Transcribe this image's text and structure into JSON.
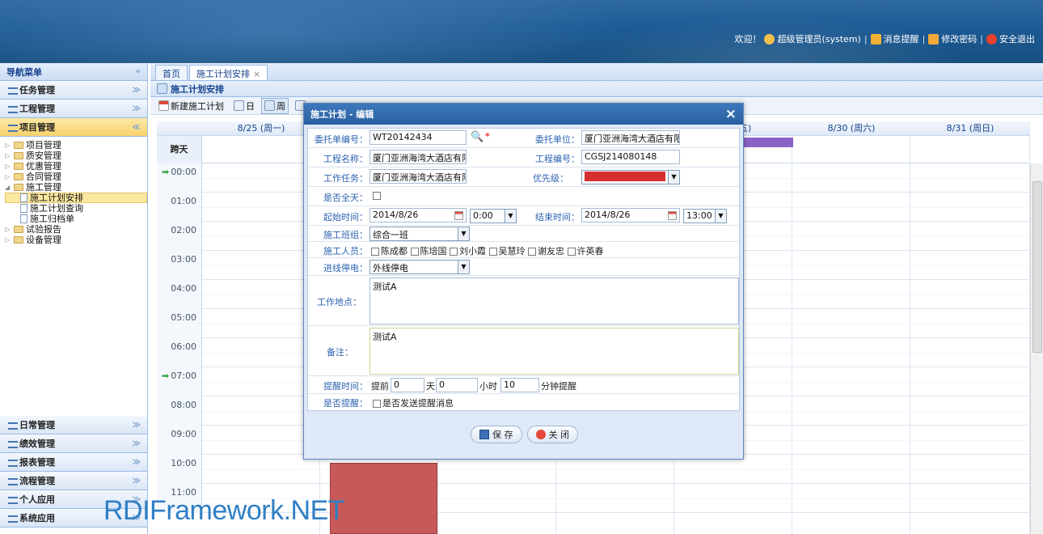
{
  "header": {
    "welcome": "欢迎！",
    "user": "超级管理员(system)",
    "messages": "消息提醒",
    "change_password": "修改密码",
    "logout": "安全退出"
  },
  "sidebar": {
    "title": "导航菜单",
    "collapse_glyph": "«",
    "groups_top": [
      {
        "label": "任务管理"
      },
      {
        "label": "工程管理"
      },
      {
        "label": "项目管理"
      }
    ],
    "tree": [
      {
        "label": "项目管理",
        "level": 0
      },
      {
        "label": "质安管理",
        "level": 0
      },
      {
        "label": "优惠管理",
        "level": 0
      },
      {
        "label": "合同管理",
        "level": 0
      },
      {
        "label": "施工管理",
        "level": 0
      },
      {
        "label": "施工计划安排",
        "level": 1
      },
      {
        "label": "施工计划查询",
        "level": 1
      },
      {
        "label": "施工归档单",
        "level": 1
      },
      {
        "label": "试验报告",
        "level": 0
      },
      {
        "label": "设备管理",
        "level": 0
      }
    ],
    "groups_bottom": [
      {
        "label": "日常管理"
      },
      {
        "label": "绩效管理"
      },
      {
        "label": "报表管理"
      },
      {
        "label": "流程管理"
      },
      {
        "label": "个人应用"
      },
      {
        "label": "系统应用"
      }
    ]
  },
  "tabs": [
    {
      "label": "首页"
    },
    {
      "label": "施工计划安排",
      "close": "×"
    }
  ],
  "panel_title": "施工计划安排",
  "toolbar": {
    "new_plan": "新建施工计划",
    "day": "日",
    "week": "周"
  },
  "calendar": {
    "allday_label": "跨天",
    "days": [
      {
        "label": "8/25 (周一)"
      },
      {
        "label": ""
      },
      {
        "label": ""
      },
      {
        "label": ""
      },
      {
        "label": "五)"
      },
      {
        "label": "8/30 (周六)"
      },
      {
        "label": "8/31 (周日)"
      }
    ],
    "hours": [
      "00:00",
      "01:00",
      "02:00",
      "03:00",
      "04:00",
      "05:00",
      "06:00",
      "07:00",
      "08:00",
      "09:00",
      "10:00",
      "11:00"
    ]
  },
  "watermark": "RDIFramework.NET",
  "dialog": {
    "title": "施工计划 - 编辑",
    "close_glyph": "×",
    "fields": {
      "entrust_no": {
        "label": "委托单编号：",
        "value": "WT20142434"
      },
      "entrust_unit": {
        "label": "委托单位：",
        "value": "厦门亚洲海湾大酒店有限"
      },
      "project_name": {
        "label": "工程名称：",
        "value": "厦门亚洲海湾大酒店有限"
      },
      "project_no": {
        "label": "工程编号：",
        "value": "CGSJ214080148"
      },
      "task": {
        "label": "工作任务：",
        "value": "厦门亚洲海湾大酒店有限"
      },
      "priority": {
        "label": "优先级：",
        "color": "#d62f2f"
      },
      "allday": {
        "label": "是否全天："
      },
      "start": {
        "label": "起始时间：",
        "date": "2014/8/26",
        "time": "0:00"
      },
      "end": {
        "label": "结束时间：",
        "date": "2014/8/26",
        "time": "13:00"
      },
      "team": {
        "label": "施工班组：",
        "value": "综合一班"
      },
      "workers": {
        "label": "施工人员：",
        "list": [
          "陈成都",
          "陈培国",
          "刘小霞",
          "吴慧玲",
          "谢友忠",
          "许英春"
        ]
      },
      "power": {
        "label": "进线停电：",
        "value": "外线停电"
      },
      "location": {
        "label": "工作地点：",
        "value": "测试A"
      },
      "remark": {
        "label": "备注：",
        "value": "测试A"
      },
      "remind_time": {
        "label": "提醒时间：",
        "before": "提前",
        "days": "0",
        "days_unit": "天",
        "hours": "0",
        "hours_unit": "小时",
        "minutes": "10",
        "minutes_unit": "分钟提醒"
      },
      "remind": {
        "label": "是否提醒：",
        "option": "是否发送提醒消息"
      }
    },
    "save": "保 存",
    "close": "关 闭"
  }
}
